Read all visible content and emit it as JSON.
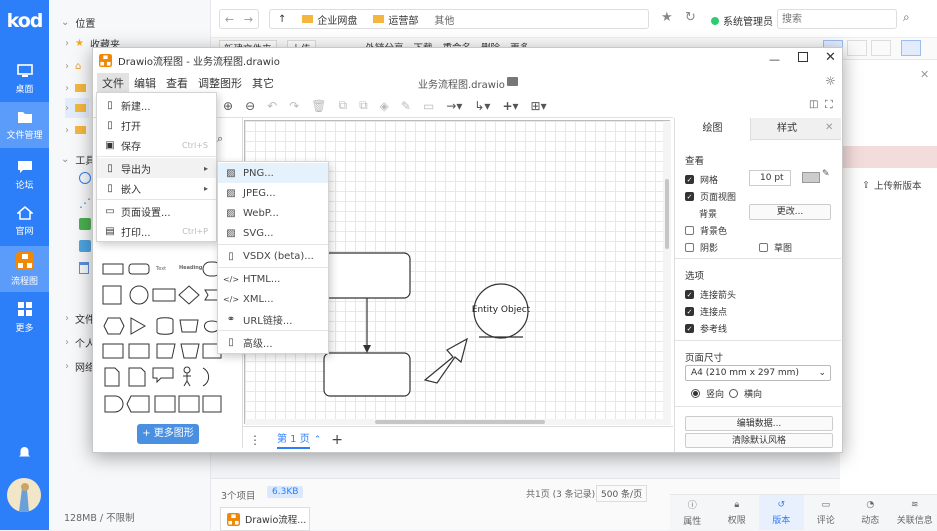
{
  "rail": {
    "logo": "kod",
    "items": [
      {
        "label": "桌面",
        "icon": "desktop-icon"
      },
      {
        "label": "文件管理",
        "icon": "folder-icon"
      },
      {
        "label": "论坛",
        "icon": "chat-icon"
      },
      {
        "label": "官网",
        "icon": "home-icon"
      },
      {
        "label": "流程图",
        "icon": "flowchart-icon"
      },
      {
        "label": "更多",
        "icon": "grid-icon"
      }
    ]
  },
  "tree": {
    "location": "位置",
    "favorites": "收藏夹",
    "tools": "工具",
    "file": "文件",
    "personal": "个人",
    "network": "网络",
    "quota": "128MB / 不限制"
  },
  "explorer": {
    "crumbs": [
      "企业网盘",
      "运营部",
      "其他"
    ],
    "user": "系统管理员",
    "search_placeholder": "搜索",
    "toolbar": [
      "新建文件夹",
      "上传",
      "外链分享",
      "下载",
      "重命名",
      "删除",
      "更多"
    ],
    "item_count": "3个项目",
    "size_badge": "6.3KB",
    "page_info": "共1页 (3 条记录)",
    "per_page": "500 条/页",
    "taskbar_item": "Drawio流程...",
    "upgrade": "上传新版本",
    "right_tabs": [
      "属性",
      "权限",
      "版本",
      "评论",
      "动态",
      "关联信息"
    ]
  },
  "drawio": {
    "window_title": "Drawio流程图 - 业务流程图.drawio",
    "doc_title": "业务流程图.drawio",
    "menus": [
      "文件",
      "编辑",
      "查看",
      "调整图形",
      "其它"
    ],
    "file_menu": [
      {
        "label": "新建...",
        "shortcut": ""
      },
      {
        "label": "打开",
        "shortcut": ""
      },
      {
        "label": "保存",
        "shortcut": "Ctrl+S"
      },
      {
        "label": "导出为",
        "shortcut": ""
      },
      {
        "label": "嵌入",
        "shortcut": ""
      },
      {
        "label": "页面设置...",
        "shortcut": ""
      },
      {
        "label": "打印...",
        "shortcut": "Ctrl+P"
      }
    ],
    "export_menu": [
      "PNG...",
      "JPEG...",
      "WebP...",
      "SVG...",
      "VSDX (beta)...",
      "HTML...",
      "XML...",
      "URL链接...",
      "高级..."
    ],
    "shape_label_text": "Text",
    "shape_label_heading": "Heading",
    "more_shapes": "+ 更多图形",
    "page_tab": "第 1 页",
    "entity_label": "Entity Object",
    "format": {
      "tabs": [
        "绘图",
        "样式"
      ],
      "view": "查看",
      "grid": "网格",
      "grid_size": "10 pt",
      "page_view": "页面视图",
      "background": "背景",
      "change": "更改...",
      "bg_color": "背景色",
      "shadow": "阴影",
      "sketch": "草图",
      "options": "选项",
      "connect_arrows": "连接箭头",
      "connect_points": "连接点",
      "guides": "参考线",
      "paper_size": "页面尺寸",
      "paper_value": "A4 (210 mm x 297 mm)",
      "portrait": "竖向",
      "landscape": "横向",
      "edit_data": "编辑数据...",
      "clear_style": "清除默认风格"
    }
  },
  "colors": {
    "accent": "#2d7ff9",
    "drawio_orange": "#f08705"
  }
}
